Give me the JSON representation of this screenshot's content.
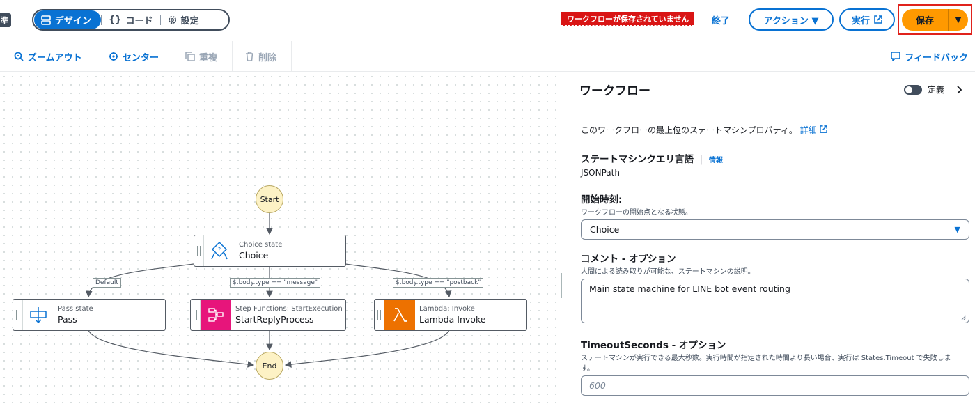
{
  "topbar": {
    "left_tag": "準",
    "tabs": [
      {
        "label": "デザイン",
        "icon": "design-icon",
        "active": true
      },
      {
        "label": "コード",
        "icon": "code-braces-icon",
        "active": false
      },
      {
        "label": "設定",
        "icon": "gear-icon",
        "active": false
      }
    ],
    "unsaved_badge": "ワークフローが保存されていません",
    "exit_label": "終了",
    "actions_label": "アクション ▼",
    "run_label": "実行",
    "save_label": "保存",
    "save_dropdown": "▼",
    "colors": {
      "primary": "#0972d3",
      "save": "#ff9900",
      "danger": "#d91515"
    }
  },
  "toolbar": {
    "zoom_out": "ズームアウト",
    "center": "センター",
    "duplicate": "重複",
    "delete": "削除",
    "feedback": "フィードバック"
  },
  "canvas": {
    "start": "Start",
    "end": "End",
    "states": [
      {
        "type": "Choice state",
        "name": "Choice",
        "icon": "choice-icon"
      },
      {
        "type": "Pass state",
        "name": "Pass",
        "icon": "pass-icon"
      },
      {
        "type": "Step Functions: StartExecution",
        "name": "StartReplyProcess",
        "icon": "step-functions-icon",
        "color": "#e7157b"
      },
      {
        "type": "Lambda: Invoke",
        "name": "Lambda Invoke",
        "icon": "lambda-icon",
        "color": "#ed7100"
      }
    ],
    "edge_labels": [
      "Default",
      "$.body.type == \"message\"",
      "$.body.type == \"postback\""
    ]
  },
  "panel": {
    "title": "ワークフロー",
    "definition_label": "定義",
    "description": "このワークフローの最上位のステートマシンプロパティ。",
    "details_link": "詳細",
    "query_language": {
      "label": "ステートマシンクエリ言語",
      "info": "情報",
      "value": "JSONPath"
    },
    "start_at": {
      "label": "開始時刻:",
      "sub": "ワークフローの開始点となる状態。",
      "value": "Choice"
    },
    "comment": {
      "label": "コメント - オプション",
      "sub": "人間による読み取りが可能な、ステートマシンの説明。",
      "value": "Main state machine for LINE bot event routing"
    },
    "timeout": {
      "label": "TimeoutSeconds - オプション",
      "sub": "ステートマシンが実行できる最大秒数。実行時間が指定された時間より長い場合、実行は States.Timeout で失敗します。",
      "placeholder": "600"
    }
  }
}
